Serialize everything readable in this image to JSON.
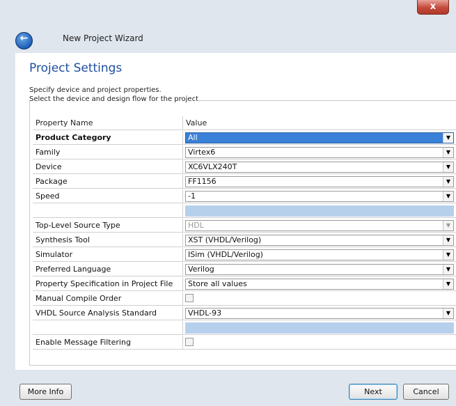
{
  "window": {
    "close_glyph": "x"
  },
  "header": {
    "back_icon": "back-arrow-icon",
    "title": "New Project Wizard"
  },
  "page": {
    "title": "Project Settings",
    "desc1": "Specify device and project properties.",
    "desc2": "Select the device and design flow for the project"
  },
  "grid": {
    "header": {
      "name": "Property Name",
      "value": "Value"
    },
    "rows": [
      {
        "name": "Product Category",
        "value": "All"
      },
      {
        "name": "Family",
        "value": "Virtex6"
      },
      {
        "name": "Device",
        "value": "XC6VLX240T"
      },
      {
        "name": "Package",
        "value": "FF1156"
      },
      {
        "name": "Speed",
        "value": "-1"
      },
      {
        "name": "Top-Level Source Type",
        "value": "HDL"
      },
      {
        "name": "Synthesis Tool",
        "value": "XST (VHDL/Verilog)"
      },
      {
        "name": "Simulator",
        "value": "ISim (VHDL/Verilog)"
      },
      {
        "name": "Preferred Language",
        "value": "Verilog"
      },
      {
        "name": "Property Specification in Project File",
        "value": "Store all values"
      },
      {
        "name": "Manual Compile Order",
        "checked": false
      },
      {
        "name": "VHDL Source Analysis Standard",
        "value": "VHDL-93"
      },
      {
        "name": "Enable Message Filtering",
        "checked": false
      }
    ]
  },
  "footer": {
    "more_info": "More Info",
    "next": "Next",
    "cancel": "Cancel"
  },
  "colors": {
    "selection": "#3b80d8",
    "title_blue": "#1e4fa0",
    "chrome": "#dfe6ee"
  }
}
